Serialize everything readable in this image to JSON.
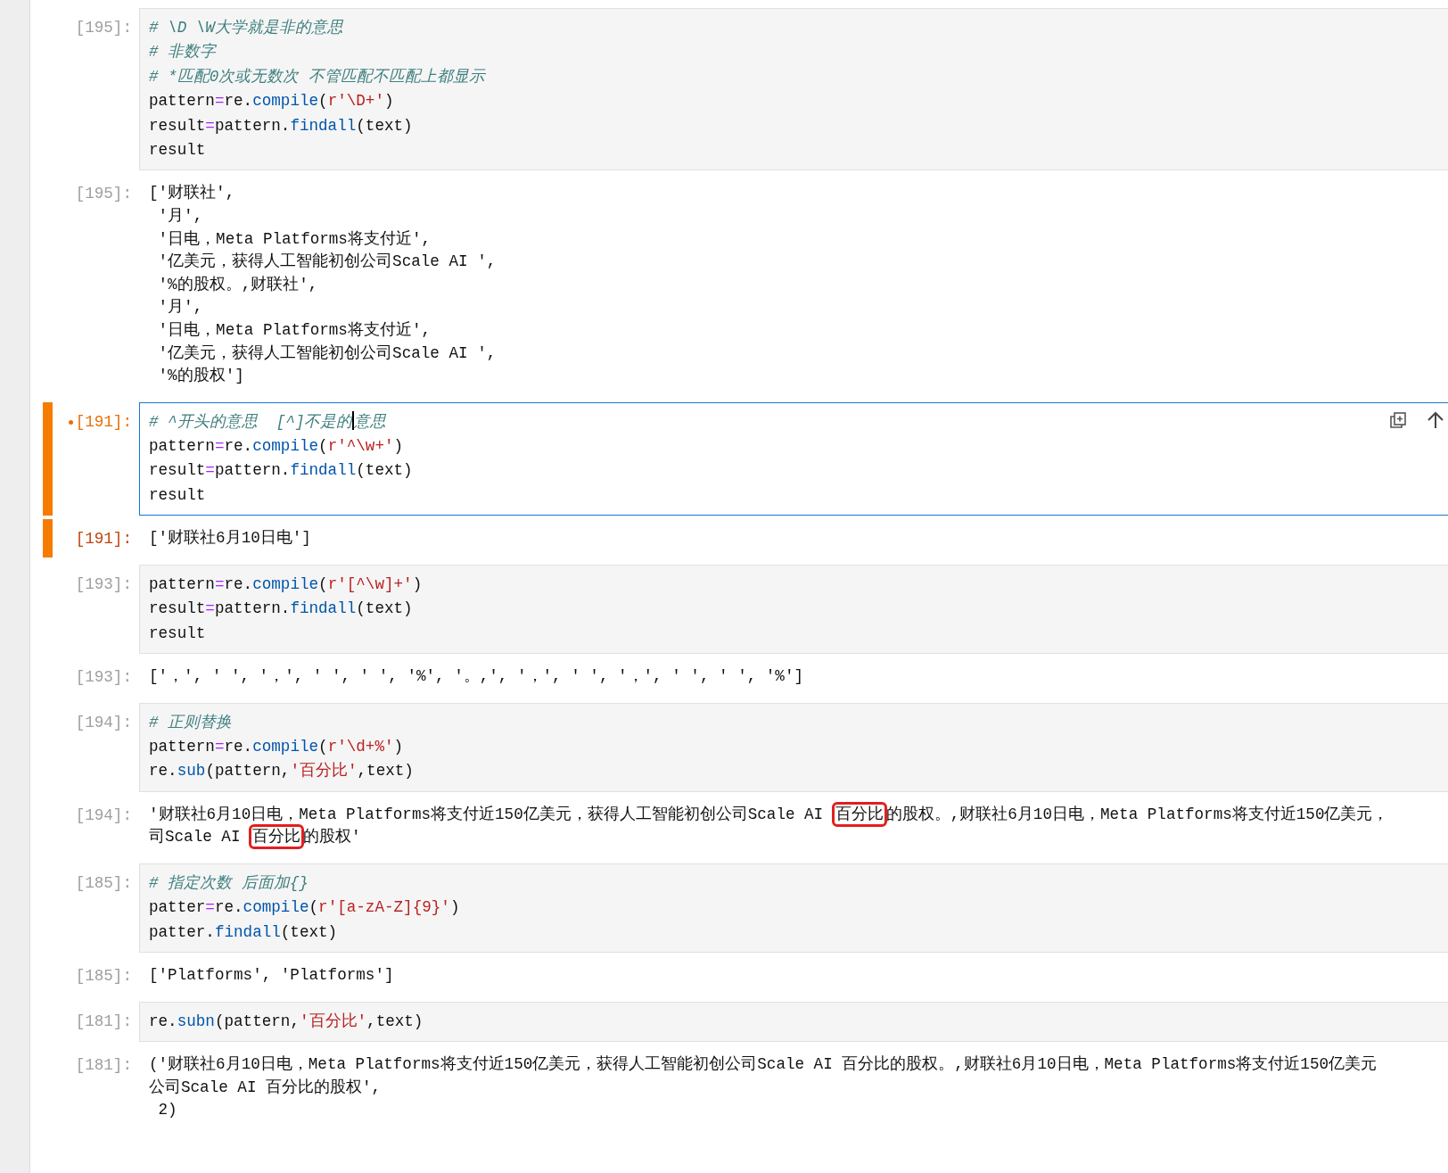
{
  "cells": [
    {
      "selected": false,
      "modified": false,
      "input": {
        "prompt": "[195]:",
        "lines": [
          [
            {
              "kind": "comment",
              "text": "# \\D \\W大学就是非的意思"
            }
          ],
          [
            {
              "kind": "comment",
              "text": "# 非数字"
            }
          ],
          [
            {
              "kind": "comment",
              "text": "# *匹配0次或无数次 不管匹配不匹配上都显示"
            }
          ],
          [
            {
              "kind": "plain",
              "text": "pattern"
            },
            {
              "kind": "op",
              "text": "="
            },
            {
              "kind": "plain",
              "text": "re."
            },
            {
              "kind": "func",
              "text": "compile"
            },
            {
              "kind": "plain",
              "text": "("
            },
            {
              "kind": "str",
              "text": "r'\\D+'"
            },
            {
              "kind": "plain",
              "text": ")"
            }
          ],
          [
            {
              "kind": "plain",
              "text": "result"
            },
            {
              "kind": "op",
              "text": "="
            },
            {
              "kind": "plain",
              "text": "pattern."
            },
            {
              "kind": "func",
              "text": "findall"
            },
            {
              "kind": "plain",
              "text": "(text)"
            }
          ],
          [
            {
              "kind": "plain",
              "text": "result"
            }
          ]
        ]
      },
      "output": {
        "prompt": "[195]:",
        "lines": [
          "['财联社',",
          " '月',",
          " '日电，Meta Platforms将支付近',",
          " '亿美元，获得人工智能初创公司Scale AI ',",
          " '%的股权。,财联社',",
          " '月',",
          " '日电，Meta Platforms将支付近',",
          " '亿美元，获得人工智能初创公司Scale AI ',",
          " '%的股权']"
        ]
      }
    },
    {
      "selected": true,
      "modified": true,
      "input": {
        "prompt": "[191]:",
        "lines": [
          [
            {
              "kind": "comment",
              "text": "# ^开头的意思  [^]不是的"
            },
            {
              "kind": "comment",
              "text": "意思",
              "caret": true
            }
          ],
          [
            {
              "kind": "plain",
              "text": "pattern"
            },
            {
              "kind": "op",
              "text": "="
            },
            {
              "kind": "plain",
              "text": "re."
            },
            {
              "kind": "func",
              "text": "compile"
            },
            {
              "kind": "plain",
              "text": "("
            },
            {
              "kind": "str",
              "text": "r'^\\w+'"
            },
            {
              "kind": "plain",
              "text": ")"
            }
          ],
          [
            {
              "kind": "plain",
              "text": "result"
            },
            {
              "kind": "op",
              "text": "="
            },
            {
              "kind": "plain",
              "text": "pattern."
            },
            {
              "kind": "func",
              "text": "findall"
            },
            {
              "kind": "plain",
              "text": "(text)"
            }
          ],
          [
            {
              "kind": "plain",
              "text": "result"
            }
          ]
        ]
      },
      "output": {
        "prompt": "[191]:",
        "lines": [
          "['财联社6月10日电']"
        ]
      }
    },
    {
      "selected": false,
      "modified": false,
      "input": {
        "prompt": "[193]:",
        "lines": [
          [
            {
              "kind": "plain",
              "text": "pattern"
            },
            {
              "kind": "op",
              "text": "="
            },
            {
              "kind": "plain",
              "text": "re."
            },
            {
              "kind": "func",
              "text": "compile"
            },
            {
              "kind": "plain",
              "text": "("
            },
            {
              "kind": "str",
              "text": "r'[^\\w]+'"
            },
            {
              "kind": "plain",
              "text": ")"
            }
          ],
          [
            {
              "kind": "plain",
              "text": "result"
            },
            {
              "kind": "op",
              "text": "="
            },
            {
              "kind": "plain",
              "text": "pattern."
            },
            {
              "kind": "func",
              "text": "findall"
            },
            {
              "kind": "plain",
              "text": "(text)"
            }
          ],
          [
            {
              "kind": "plain",
              "text": "result"
            }
          ]
        ]
      },
      "output": {
        "prompt": "[193]:",
        "lines": [
          "['，', ' ', '，', ' ', ' ', '%', '。,', '，', ' ', '，', ' ', ' ', '%']"
        ]
      }
    },
    {
      "selected": false,
      "modified": false,
      "input": {
        "prompt": "[194]:",
        "lines": [
          [
            {
              "kind": "comment",
              "text": "# 正则替换"
            }
          ],
          [
            {
              "kind": "plain",
              "text": "pattern"
            },
            {
              "kind": "op",
              "text": "="
            },
            {
              "kind": "plain",
              "text": "re."
            },
            {
              "kind": "func",
              "text": "compile"
            },
            {
              "kind": "plain",
              "text": "("
            },
            {
              "kind": "str",
              "text": "r'\\d+%'"
            },
            {
              "kind": "plain",
              "text": ")"
            }
          ],
          [
            {
              "kind": "plain",
              "text": "re."
            },
            {
              "kind": "func",
              "text": "sub"
            },
            {
              "kind": "plain",
              "text": "(pattern,"
            },
            {
              "kind": "str",
              "text": "'百分比'"
            },
            {
              "kind": "plain",
              "text": ",text)"
            }
          ]
        ]
      },
      "output": {
        "prompt": "[194]:",
        "lines": [
          [
            {
              "text": "'财联社6月10日电，Meta Platforms将支付近150亿美元，获得人工智能初创公司Scale AI ",
              "boxed": false
            },
            {
              "text": "百分比",
              "boxed": true
            },
            {
              "text": "的股权。,财联社6月10日电，Meta Platforms将支付近150亿美元，",
              "boxed": false
            }
          ],
          [
            {
              "text": "司Scale AI ",
              "boxed": false
            },
            {
              "text": "百分比",
              "boxed": true
            },
            {
              "text": "的股权'",
              "boxed": false
            }
          ]
        ]
      }
    },
    {
      "selected": false,
      "modified": false,
      "input": {
        "prompt": "[185]:",
        "lines": [
          [
            {
              "kind": "comment",
              "text": "# 指定次数 后面加{}"
            }
          ],
          [
            {
              "kind": "plain",
              "text": "patter"
            },
            {
              "kind": "op",
              "text": "="
            },
            {
              "kind": "plain",
              "text": "re."
            },
            {
              "kind": "func",
              "text": "compile"
            },
            {
              "kind": "plain",
              "text": "("
            },
            {
              "kind": "str",
              "text": "r'[a-zA-Z]{9}'"
            },
            {
              "kind": "plain",
              "text": ")"
            }
          ],
          [
            {
              "kind": "plain",
              "text": "patter."
            },
            {
              "kind": "func",
              "text": "findall"
            },
            {
              "kind": "plain",
              "text": "(text)"
            }
          ]
        ]
      },
      "output": {
        "prompt": "[185]:",
        "lines": [
          "['Platforms', 'Platforms']"
        ]
      }
    },
    {
      "selected": false,
      "modified": false,
      "input": {
        "prompt": "[181]:",
        "lines": [
          [
            {
              "kind": "plain",
              "text": "re."
            },
            {
              "kind": "func",
              "text": "subn"
            },
            {
              "kind": "plain",
              "text": "(pattern,"
            },
            {
              "kind": "str",
              "text": "'百分比'"
            },
            {
              "kind": "plain",
              "text": ",text)"
            }
          ]
        ]
      },
      "output": {
        "prompt": "[181]:",
        "lines": [
          "('财联社6月10日电，Meta Platforms将支付近150亿美元，获得人工智能初创公司Scale AI 百分比的股权。,财联社6月10日电，Meta Platforms将支付近150亿美元",
          "公司Scale AI 百分比的股权',",
          " 2)"
        ]
      }
    }
  ]
}
